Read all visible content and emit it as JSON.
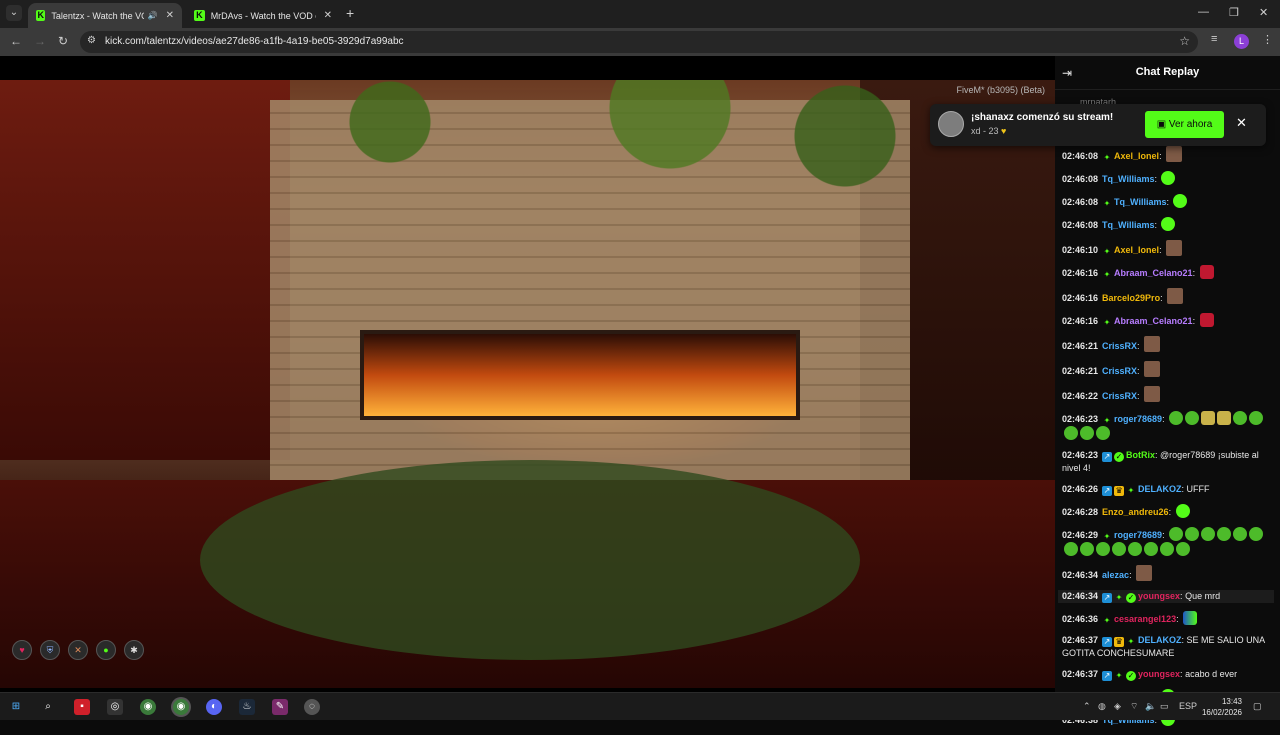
{
  "tabs": [
    {
      "title": "Talentzx - Watch the VOD o",
      "active": true,
      "favicon": "K"
    },
    {
      "title": "MrDAvs - Watch the VOD on Ki",
      "active": false,
      "favicon": "K"
    }
  ],
  "address": {
    "url": "kick.com/talentzx/videos/ae27de86-a1fb-4a19-be05-3929d7a99abc"
  },
  "profile_initial": "L",
  "video": {
    "overlay_text": "FiveM* (b3095) (Beta)",
    "hud_icons": [
      "heart-icon",
      "shield-icon",
      "hunger-icon",
      "water-icon",
      "stress-icon"
    ]
  },
  "chat": {
    "title": "Chat Replay",
    "pinned_partial": "mrpatarh",
    "messages": [
      {
        "time": "02:46:08",
        "badges": [
          "sub"
        ],
        "user": "Axel_Ionel",
        "color": "#f0b90b",
        "emotes": [
          "face"
        ],
        "text": ""
      },
      {
        "time": "02:46:08",
        "badges": [],
        "user": "Tq_Williams",
        "color": "#4fb1ff",
        "emotes": [
          "green"
        ],
        "text": ""
      },
      {
        "time": "02:46:08",
        "badges": [
          "sub"
        ],
        "user": "Tq_Williams",
        "color": "#4fb1ff",
        "emotes": [
          "green"
        ],
        "text": ""
      },
      {
        "time": "02:46:08",
        "badges": [],
        "user": "Tq_Williams",
        "color": "#4fb1ff",
        "emotes": [
          "green"
        ],
        "text": ""
      },
      {
        "time": "02:46:10",
        "badges": [
          "sub"
        ],
        "user": "Axel_Ionel",
        "color": "#f0b90b",
        "emotes": [
          "face"
        ],
        "text": ""
      },
      {
        "time": "02:46:16",
        "badges": [
          "sub"
        ],
        "user": "Abraam_Celano21",
        "color": "#b77dff",
        "emotes": [
          "red"
        ],
        "text": ""
      },
      {
        "time": "02:46:16",
        "badges": [],
        "user": "Barcelo29Pro",
        "color": "#f0b90b",
        "emotes": [
          "face"
        ],
        "text": ""
      },
      {
        "time": "02:46:16",
        "badges": [
          "sub"
        ],
        "user": "Abraam_Celano21",
        "color": "#b77dff",
        "emotes": [
          "red"
        ],
        "text": ""
      },
      {
        "time": "02:46:21",
        "badges": [],
        "user": "CrissRX",
        "color": "#4fb1ff",
        "emotes": [
          "face"
        ],
        "text": ""
      },
      {
        "time": "02:46:21",
        "badges": [],
        "user": "CrissRX",
        "color": "#4fb1ff",
        "emotes": [
          "face"
        ],
        "text": ""
      },
      {
        "time": "02:46:22",
        "badges": [],
        "user": "CrissRX",
        "color": "#4fb1ff",
        "emotes": [
          "face"
        ],
        "text": ""
      },
      {
        "time": "02:46:23",
        "badges": [
          "sub"
        ],
        "user": "roger78689",
        "color": "#4fb1ff",
        "emotes": [
          "small",
          "small",
          "yellow",
          "yellow",
          "small",
          "small",
          "small",
          "small",
          "small"
        ],
        "text": ""
      },
      {
        "time": "02:46:23",
        "badges": [
          "vip",
          "ok"
        ],
        "user": "BotRix",
        "color": "#53fc18",
        "emotes": [],
        "text": "@roger78689 ¡subiste al nivel 4!"
      },
      {
        "time": "02:46:26",
        "badges": [
          "vip",
          "crown",
          "sub"
        ],
        "user": "DELAKOZ",
        "color": "#4fb1ff",
        "emotes": [],
        "text": "UFFF"
      },
      {
        "time": "02:46:28",
        "badges": [],
        "user": "Enzo_andreu26",
        "color": "#f0b90b",
        "emotes": [
          "green"
        ],
        "text": ""
      },
      {
        "time": "02:46:29",
        "badges": [
          "sub"
        ],
        "user": "roger78689",
        "color": "#4fb1ff",
        "emotes": [
          "small",
          "small",
          "small",
          "small",
          "small",
          "small",
          "small",
          "small",
          "small",
          "small",
          "small",
          "small",
          "small",
          "small"
        ],
        "text": ""
      },
      {
        "time": "02:46:34",
        "badges": [],
        "user": "alezac",
        "color": "#4fb1ff",
        "emotes": [
          "face"
        ],
        "text": ""
      },
      {
        "time": "02:46:34",
        "badges": [
          "vip",
          "sub",
          "ok"
        ],
        "user": "youngsex",
        "color": "#e0245e",
        "emotes": [],
        "text": "Que mrd",
        "highlight": true
      },
      {
        "time": "02:46:36",
        "badges": [
          "sub"
        ],
        "user": "cesarangel123",
        "color": "#e0245e",
        "emotes": [
          "mix"
        ],
        "text": ""
      },
      {
        "time": "02:46:37",
        "badges": [
          "vip",
          "crown",
          "sub"
        ],
        "user": "DELAKOZ",
        "color": "#4fb1ff",
        "emotes": [],
        "text": "SE ME SALIO UNA GOTITA CONCHESUMARE"
      },
      {
        "time": "02:46:37",
        "badges": [
          "vip",
          "sub",
          "ok"
        ],
        "user": "youngsex",
        "color": "#e0245e",
        "emotes": [],
        "text": "acabo d ever"
      },
      {
        "time": "02:46:38",
        "badges": [],
        "user": "Tq_Williams",
        "color": "#4fb1ff",
        "emotes": [
          "green"
        ],
        "text": ""
      },
      {
        "time": "02:46:38",
        "badges": [],
        "user": "Tq_Williams",
        "color": "#4fb1ff",
        "emotes": [
          "green"
        ],
        "text": ""
      }
    ]
  },
  "toast": {
    "title": "¡shanaxz comenzó su stream!",
    "subtitle": "xd - 23",
    "button_label": "Ver ahora"
  },
  "taskbar": {
    "lang": "ESP",
    "time": "13:43",
    "date": "16/02/2026"
  },
  "colors": {
    "accent": "#53fc18",
    "chat_bg": "#0c0c0c"
  }
}
